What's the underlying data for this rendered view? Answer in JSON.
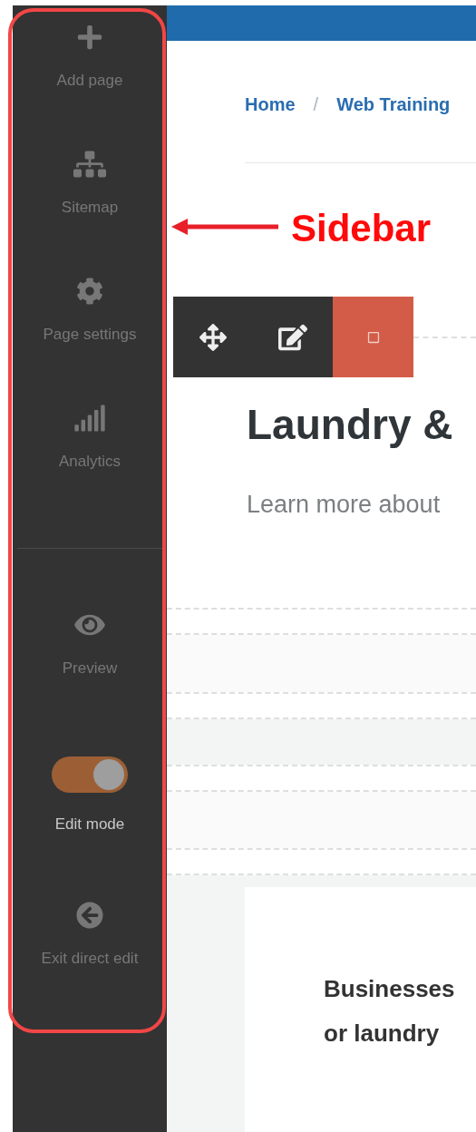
{
  "sidebar": {
    "items": [
      {
        "kind": "link",
        "label": "Add page"
      },
      {
        "kind": "link",
        "label": "Sitemap"
      },
      {
        "kind": "link",
        "label": "Page settings"
      },
      {
        "kind": "link",
        "label": "Analytics"
      }
    ],
    "bottom_items": [
      {
        "kind": "link",
        "label": "Preview"
      },
      {
        "kind": "toggle",
        "label": "Edit mode",
        "on": true
      },
      {
        "kind": "link",
        "label": "Exit direct edit"
      }
    ]
  },
  "breadcrumb": {
    "items": [
      {
        "label": "Home"
      },
      {
        "label": "Web Training"
      }
    ],
    "separator": "/"
  },
  "page": {
    "title": "Laundry &",
    "subtitle": "Learn more about",
    "card_lines": [
      "Businesses",
      "or laundry"
    ]
  },
  "annotation": {
    "label": "Sidebar"
  }
}
